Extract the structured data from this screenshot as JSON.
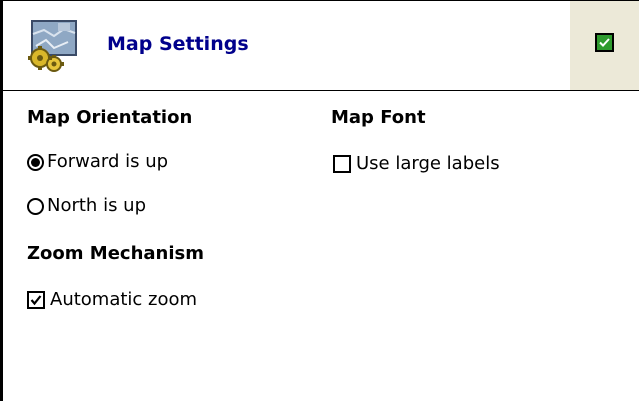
{
  "header": {
    "title": "Map Settings",
    "app_icon": "map-settings-icon",
    "ok_icon": "ok-checkbox-icon",
    "accent_color": "#00008c",
    "ok_color": "#2f9b2f"
  },
  "map_orientation": {
    "heading": "Map Orientation",
    "options": [
      {
        "label": "Forward is up",
        "selected": true
      },
      {
        "label": "North is up",
        "selected": false
      }
    ]
  },
  "zoom_mechanism": {
    "heading": "Zoom Mechanism",
    "automatic_zoom": {
      "label": "Automatic zoom",
      "checked": true
    }
  },
  "map_font": {
    "heading": "Map Font",
    "large_labels": {
      "label": "Use large labels",
      "checked": false
    }
  }
}
